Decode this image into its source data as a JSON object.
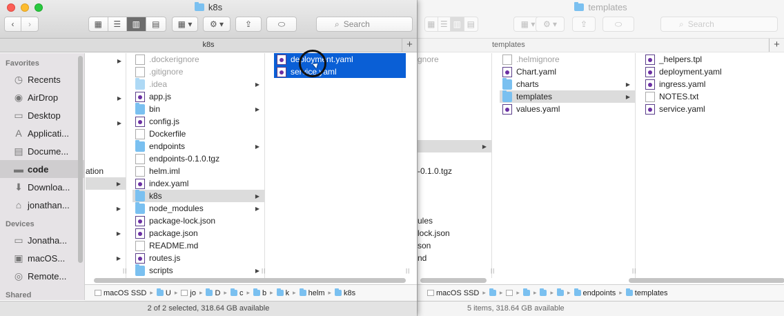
{
  "front_window": {
    "title": "k8s",
    "tab_label": "k8s",
    "search_placeholder": "Search",
    "sidebar": {
      "favorites_header": "Favorites",
      "favorites": [
        {
          "label": "Recents",
          "icon": "recents-icon"
        },
        {
          "label": "AirDrop",
          "icon": "airdrop-icon"
        },
        {
          "label": "Desktop",
          "icon": "desktop-icon"
        },
        {
          "label": "Applicati...",
          "icon": "applications-icon"
        },
        {
          "label": "Docume...",
          "icon": "documents-icon"
        },
        {
          "label": "code",
          "icon": "folder-icon",
          "selected": true
        },
        {
          "label": "Downloa...",
          "icon": "downloads-icon"
        },
        {
          "label": "jonathan...",
          "icon": "home-icon"
        }
      ],
      "devices_header": "Devices",
      "devices": [
        {
          "label": "Jonatha...",
          "icon": "computer-icon"
        },
        {
          "label": "macOS...",
          "icon": "disk-icon"
        },
        {
          "label": "Remote...",
          "icon": "remote-disk-icon"
        }
      ],
      "shared_header": "Shared"
    },
    "column1_partial": "ation",
    "column2": [
      {
        "name": ".dockerignore",
        "kind": "doc",
        "hidden": true
      },
      {
        "name": ".gitignore",
        "kind": "doc",
        "hidden": true
      },
      {
        "name": ".idea",
        "kind": "folder",
        "hidden": true,
        "arrow": true
      },
      {
        "name": "app.js",
        "kind": "yaml"
      },
      {
        "name": "bin",
        "kind": "folder",
        "arrow": true
      },
      {
        "name": "config.js",
        "kind": "yaml"
      },
      {
        "name": "Dockerfile",
        "kind": "doc"
      },
      {
        "name": "endpoints",
        "kind": "folder",
        "arrow": true
      },
      {
        "name": "endpoints-0.1.0.tgz",
        "kind": "doc"
      },
      {
        "name": "helm.iml",
        "kind": "doc"
      },
      {
        "name": "index.yaml",
        "kind": "yaml"
      },
      {
        "name": "k8s",
        "kind": "folder",
        "arrow": true,
        "highlight": true
      },
      {
        "name": "node_modules",
        "kind": "folder",
        "arrow": true
      },
      {
        "name": "package-lock.json",
        "kind": "yaml"
      },
      {
        "name": "package.json",
        "kind": "yaml"
      },
      {
        "name": "README.md",
        "kind": "doc"
      },
      {
        "name": "routes.js",
        "kind": "yaml"
      },
      {
        "name": "scripts",
        "kind": "folder",
        "arrow": true
      }
    ],
    "column3": [
      {
        "name": "deployment.yaml",
        "kind": "yaml",
        "selected": true
      },
      {
        "name": "service.yaml",
        "kind": "yaml",
        "selected": true
      }
    ],
    "path": [
      "macOS SSD",
      "U",
      "jo",
      "D",
      "c",
      "b",
      "k",
      "helm",
      "k8s"
    ],
    "status": "2 of 2 selected, 318.64 GB available"
  },
  "back_window": {
    "title": "templates",
    "tab_label": "templates",
    "search_placeholder": "Search",
    "column0_partial": [
      {
        "name": "gnore",
        "hidden": true
      },
      {
        "name": "",
        "highlight": true,
        "arrow": true
      },
      {
        "name": "-0.1.0.tgz"
      },
      {
        "name": "ules"
      },
      {
        "name": "lock.json"
      },
      {
        "name": "son"
      },
      {
        "name": "nd"
      }
    ],
    "column1": [
      {
        "name": ".helmignore",
        "kind": "doc",
        "hidden": true
      },
      {
        "name": "Chart.yaml",
        "kind": "yaml"
      },
      {
        "name": "charts",
        "kind": "folder",
        "arrow": true
      },
      {
        "name": "templates",
        "kind": "folder",
        "arrow": true,
        "highlight": true
      },
      {
        "name": "values.yaml",
        "kind": "yaml"
      }
    ],
    "column2": [
      {
        "name": "_helpers.tpl",
        "kind": "yaml"
      },
      {
        "name": "deployment.yaml",
        "kind": "yaml"
      },
      {
        "name": "ingress.yaml",
        "kind": "yaml"
      },
      {
        "name": "NOTES.txt",
        "kind": "doc"
      },
      {
        "name": "service.yaml",
        "kind": "yaml"
      }
    ],
    "path": [
      "macOS SSD",
      "",
      "",
      "",
      "",
      "",
      "endpoints",
      "templates"
    ],
    "status": "5 items, 318.64 GB available"
  },
  "colors": {
    "selection": "#0a5fd6",
    "folder": "#7ac0f0",
    "yaml_icon": "#6b2fa3"
  }
}
